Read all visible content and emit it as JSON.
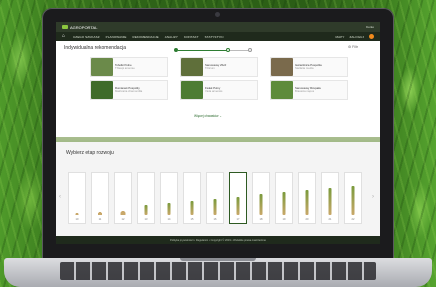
{
  "header": {
    "logo_text": "AGROPORTAL",
    "right_text": "Konto"
  },
  "nav": {
    "items": [
      "CZEGO SZUKASZ",
      "PLANOWANIE",
      "REKOMENDACJE",
      "ANALIZY",
      "KONTAKT",
      "STATYSTYKI"
    ],
    "right_items": [
      "MAPY",
      "ZALOGUJ"
    ]
  },
  "panel": {
    "title": "Indywidualna rekomendacja",
    "filter_label": "Filtr",
    "more_label": "Więcej chwastów ⌄"
  },
  "cards": [
    {
      "name": "Tobołki Polne",
      "sub": "Thlaspi arvense",
      "color": "#6b8a4a"
    },
    {
      "name": "Samosiewy Zbóż",
      "sub": "Triticum",
      "color": "#5f6f3a"
    },
    {
      "name": "Gwiazdnica Pospolita",
      "sub": "Stellaria media",
      "color": "#7a6a4c"
    },
    {
      "name": "Rumianek Pospolity",
      "sub": "Matricaria chamomilla",
      "color": "#3f6b2a"
    },
    {
      "name": "Fiołek Polny",
      "sub": "Viola arvensis",
      "color": "#4d7c33"
    },
    {
      "name": "Samosiewy Rzepaku",
      "sub": "Brassica napus",
      "color": "#5e8b3c"
    }
  ],
  "stages": {
    "title": "Wybierz etap rozwoju",
    "items": [
      "10",
      "11",
      "12",
      "13",
      "14",
      "15",
      "16",
      "17",
      "18",
      "19",
      "20",
      "21",
      "22"
    ],
    "selected_index": 7
  },
  "footer": {
    "text": "Polityka prywatności  •  Regulamin  •  Copyright © 2019  •  Wszelkie prawa zastrzeżone"
  },
  "colors": {
    "accent": "#2e7d32",
    "nav_bg": "#1f2a1c",
    "notification": "#f08a1c"
  }
}
